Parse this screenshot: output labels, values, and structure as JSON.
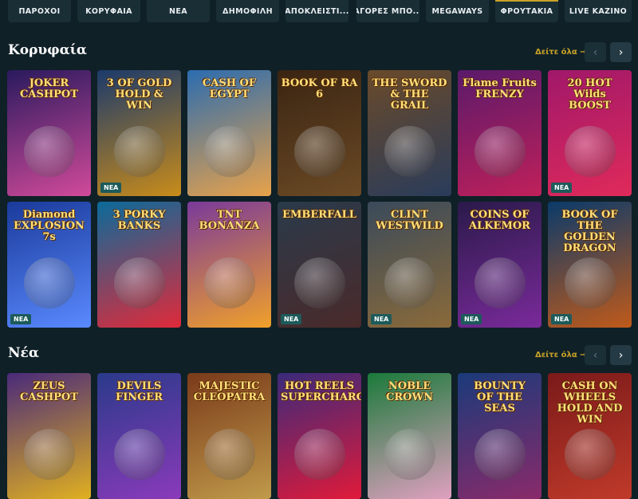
{
  "tabs": [
    {
      "label": "ΠΑΡΟΧΟΙ"
    },
    {
      "label": "ΚΟΡΥΦΑΙΑ"
    },
    {
      "label": "ΝΕΑ"
    },
    {
      "label": "ΔΗΜΟΦΙΛΗ"
    },
    {
      "label": "ΑΠΟΚΛΕΙΣΤΙ..."
    },
    {
      "label": "ΑΓΟΡΕΣ ΜΠΟ..."
    },
    {
      "label": "MEGAWAYS"
    },
    {
      "label": "ΦΡΟΥΤΑΚΙΑ"
    },
    {
      "label": "LIVE ΚΑΖΙΝΟ"
    }
  ],
  "sections": [
    {
      "title": "Κορυφαία",
      "see_all": "Δείτε όλα →",
      "games": [
        {
          "name": "JOKER\nCASHPOT",
          "badge": ""
        },
        {
          "name": "3 OF GOLD\nHOLD & WIN",
          "badge": "ΝΕΑ"
        },
        {
          "name": "CASH OF\nEGYPT",
          "badge": ""
        },
        {
          "name": "BOOK OF RA 6",
          "badge": ""
        },
        {
          "name": "THE SWORD\n& THE GRAIL",
          "badge": ""
        },
        {
          "name": "Flame Fruits\nFRENZY",
          "badge": ""
        },
        {
          "name": "20 HOT\nWilds\nBOOST",
          "badge": "ΝΕΑ"
        },
        {
          "name": "Diamond\nEXPLOSION 7s",
          "badge": "ΝΕΑ"
        },
        {
          "name": "3 PORKY\nBANKS",
          "badge": ""
        },
        {
          "name": "TNT\nBONANZA",
          "badge": ""
        },
        {
          "name": "EMBERFALL",
          "badge": "ΝΕΑ"
        },
        {
          "name": "CLINT\nWESTWILD",
          "badge": "ΝΕΑ"
        },
        {
          "name": "COINS OF\nALKEMOR",
          "badge": "ΝΕΑ"
        },
        {
          "name": "BOOK OF THE\nGOLDEN\nDRAGON",
          "badge": "ΝΕΑ"
        }
      ]
    },
    {
      "title": "Νέα",
      "see_all": "Δείτε όλα →",
      "games": [
        {
          "name": "ZEUS\nCASHPOT",
          "badge": ""
        },
        {
          "name": "DEVILS\nFINGER",
          "badge": ""
        },
        {
          "name": "MAJESTIC\nCLEOPATRA",
          "badge": ""
        },
        {
          "name": "HOT REELS\nSUPERCHARGED",
          "badge": ""
        },
        {
          "name": "NOBLE\nCROWN",
          "badge": ""
        },
        {
          "name": "BOUNTY\nOF THE\nSEAS",
          "badge": ""
        },
        {
          "name": "CASH ON WHEELS\nHOLD AND WIN",
          "badge": ""
        }
      ]
    }
  ],
  "colors": {
    "background": "#0f2027",
    "accent": "#c9a227",
    "badge": "#1d5b5b",
    "tile_colors": [
      [
        "#2a1a5e",
        "#d14a9a"
      ],
      [
        "#1b3a6b",
        "#c98c1a"
      ],
      [
        "#2b6cb0",
        "#e8a24a"
      ],
      [
        "#3a2412",
        "#6b4a25"
      ],
      [
        "#6a4a2a",
        "#2a3c5a"
      ],
      [
        "#5a1a6a",
        "#c0205a"
      ],
      [
        "#a0186a",
        "#e02a5a"
      ],
      [
        "#1a3a9a",
        "#5a8aff"
      ],
      [
        "#0a6a9a",
        "#e02a3a"
      ],
      [
        "#7a3a9a",
        "#f0a02a"
      ],
      [
        "#2a3a4a",
        "#4a2a2a"
      ],
      [
        "#3a4a5a",
        "#8a6a3a"
      ],
      [
        "#2a1a4a",
        "#7a2a9a"
      ],
      [
        "#0a3a6a",
        "#c05a1a"
      ],
      [
        "#4a2a7a",
        "#e0b020"
      ],
      [
        "#2a3a8a",
        "#8a3aba"
      ],
      [
        "#7a3a1a",
        "#c09a4a"
      ],
      [
        "#3a2a7a",
        "#e01a3a"
      ],
      [
        "#1a7a3a",
        "#e0a0c0"
      ],
      [
        "#1a3a7a",
        "#8a2a6a"
      ],
      [
        "#7a1a1a",
        "#c03a2a"
      ]
    ]
  }
}
